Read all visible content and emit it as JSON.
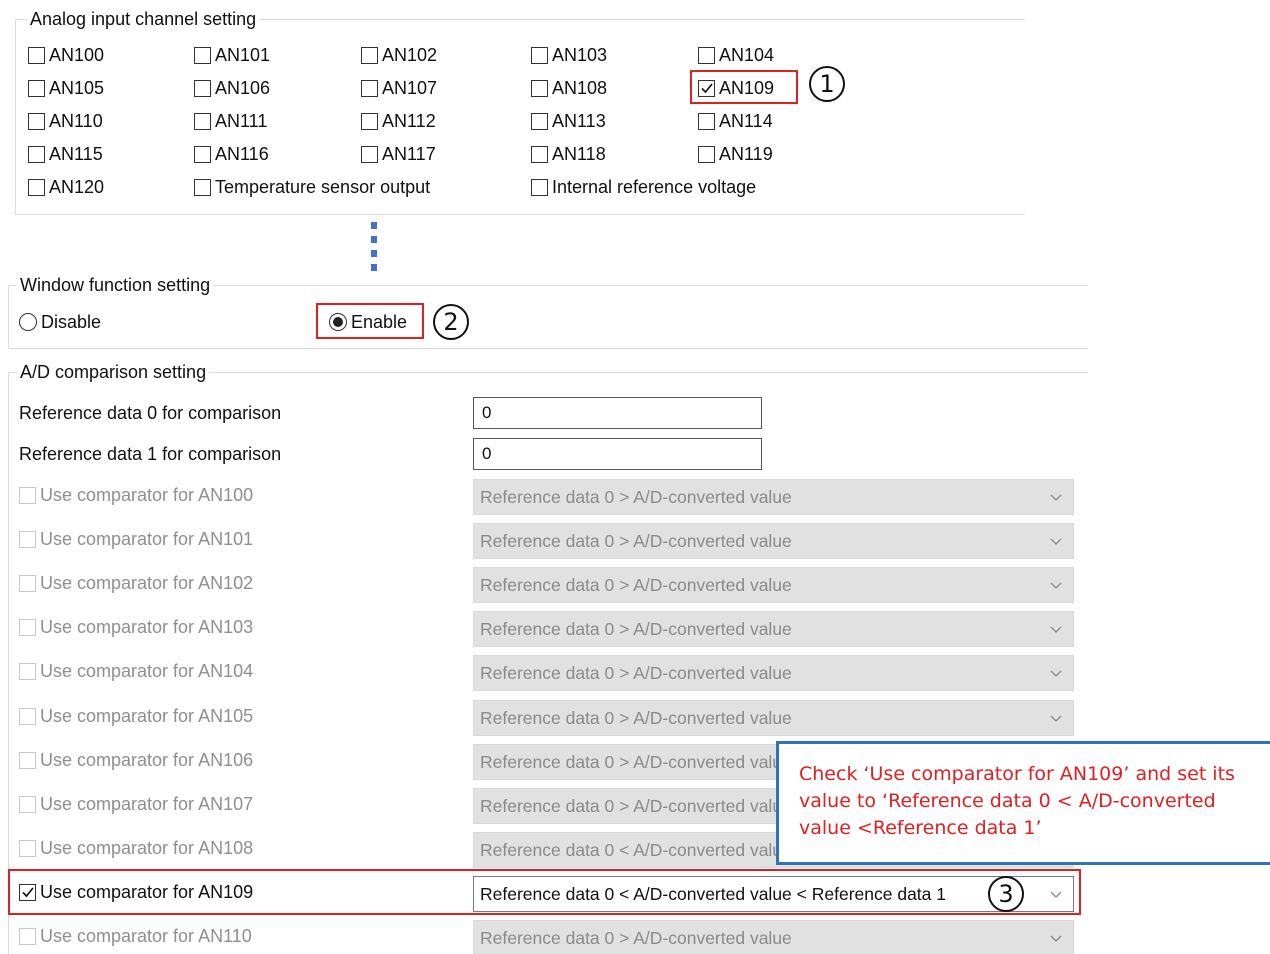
{
  "analog_group": {
    "title": "Analog input channel setting",
    "channels": [
      {
        "label": "AN100",
        "checked": false
      },
      {
        "label": "AN101",
        "checked": false
      },
      {
        "label": "AN102",
        "checked": false
      },
      {
        "label": "AN103",
        "checked": false
      },
      {
        "label": "AN104",
        "checked": false
      },
      {
        "label": "AN105",
        "checked": false
      },
      {
        "label": "AN106",
        "checked": false
      },
      {
        "label": "AN107",
        "checked": false
      },
      {
        "label": "AN108",
        "checked": false
      },
      {
        "label": "AN109",
        "checked": true
      },
      {
        "label": "AN110",
        "checked": false
      },
      {
        "label": "AN111",
        "checked": false
      },
      {
        "label": "AN112",
        "checked": false
      },
      {
        "label": "AN113",
        "checked": false
      },
      {
        "label": "AN114",
        "checked": false
      },
      {
        "label": "AN115",
        "checked": false
      },
      {
        "label": "AN116",
        "checked": false
      },
      {
        "label": "AN117",
        "checked": false
      },
      {
        "label": "AN118",
        "checked": false
      },
      {
        "label": "AN119",
        "checked": false
      },
      {
        "label": "AN120",
        "checked": false
      }
    ],
    "temp_sensor_label": "Temperature sensor output",
    "internal_ref_label": "Internal reference voltage"
  },
  "window_group": {
    "title": "Window function setting",
    "disable_label": "Disable",
    "enable_label": "Enable",
    "selected": "Enable"
  },
  "comparison_group": {
    "title": "A/D comparison setting",
    "ref0_label": "Reference data 0 for comparison",
    "ref0_value": "0",
    "ref1_label": "Reference data 1 for comparison",
    "ref1_value": "0",
    "rows": [
      {
        "label": "Use comparator for AN100",
        "checked": false,
        "enabled": false,
        "value": "Reference data 0 > A/D-converted value"
      },
      {
        "label": "Use comparator for AN101",
        "checked": false,
        "enabled": false,
        "value": "Reference data 0 > A/D-converted value"
      },
      {
        "label": "Use comparator for AN102",
        "checked": false,
        "enabled": false,
        "value": "Reference data 0 > A/D-converted value"
      },
      {
        "label": "Use comparator for AN103",
        "checked": false,
        "enabled": false,
        "value": "Reference data 0 > A/D-converted value"
      },
      {
        "label": "Use comparator for AN104",
        "checked": false,
        "enabled": false,
        "value": "Reference data 0 > A/D-converted value"
      },
      {
        "label": "Use comparator for AN105",
        "checked": false,
        "enabled": false,
        "value": "Reference data 0 > A/D-converted value"
      },
      {
        "label": "Use comparator for AN106",
        "checked": false,
        "enabled": false,
        "value": "Reference data 0 > A/D-converted value"
      },
      {
        "label": "Use comparator for AN107",
        "checked": false,
        "enabled": false,
        "value": "Reference data 0 > A/D-converted value"
      },
      {
        "label": "Use comparator for AN108",
        "checked": false,
        "enabled": false,
        "value": "Reference data 0 < A/D-converted value"
      },
      {
        "label": "Use comparator for AN109",
        "checked": true,
        "enabled": true,
        "value": "Reference data 0 < A/D-converted value < Reference data 1"
      },
      {
        "label": "Use comparator for AN110",
        "checked": false,
        "enabled": false,
        "value": "Reference data 0 > A/D-converted value"
      }
    ]
  },
  "annotations": {
    "marker_1": "1",
    "marker_2": "2",
    "marker_3": "3",
    "callout_text": "Check ‘Use comparator for AN109’ and set its value to ‘Reference data 0 < A/D-converted value <Reference data 1’",
    "highlight_color": "#e02020",
    "callout_border_color": "#2e75b6",
    "dots_color": "#4472c4"
  },
  "icons": {
    "checkmark": "checkmark-icon",
    "dropdown": "chevron-down-icon"
  }
}
